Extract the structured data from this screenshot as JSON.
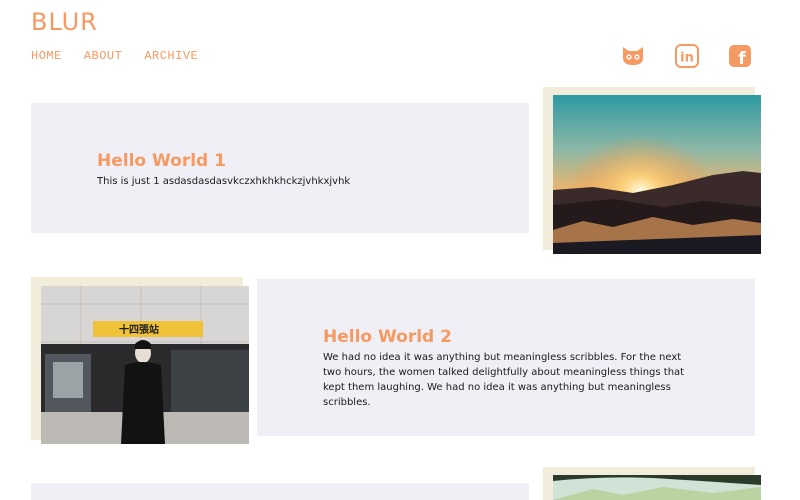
{
  "site": {
    "brand": "BLUR"
  },
  "nav": [
    "HOME",
    "ABOUT",
    "ARCHIVE"
  ],
  "social": [
    {
      "name": "github",
      "icon": "github-icon"
    },
    {
      "name": "linkedin",
      "icon": "linkedin-icon",
      "glyph": "in"
    },
    {
      "name": "facebook",
      "icon": "facebook-icon",
      "glyph": "f"
    }
  ],
  "colors": {
    "accent": "#f59a63",
    "card_bg": "#efeff5",
    "frame": "#f2ecda",
    "text": "#1a1a1a"
  },
  "posts": [
    {
      "title": "Hello World 1",
      "body": "This is just 1 asdasdasdasvkczxhkhkhckzjvhkxjvhk",
      "image": "sunset-mountain-photo"
    },
    {
      "title": "Hello World 2",
      "body": "We had no idea it was anything but meaningless scribbles. For the next two hours, the women talked delightfully about meaningless things that kept them laughing. We had no idea it was anything but meaningless scribbles.",
      "image": "station-portrait-photo",
      "sign_text": "十四張站"
    },
    {
      "image": "sky-treetop-photo"
    }
  ]
}
